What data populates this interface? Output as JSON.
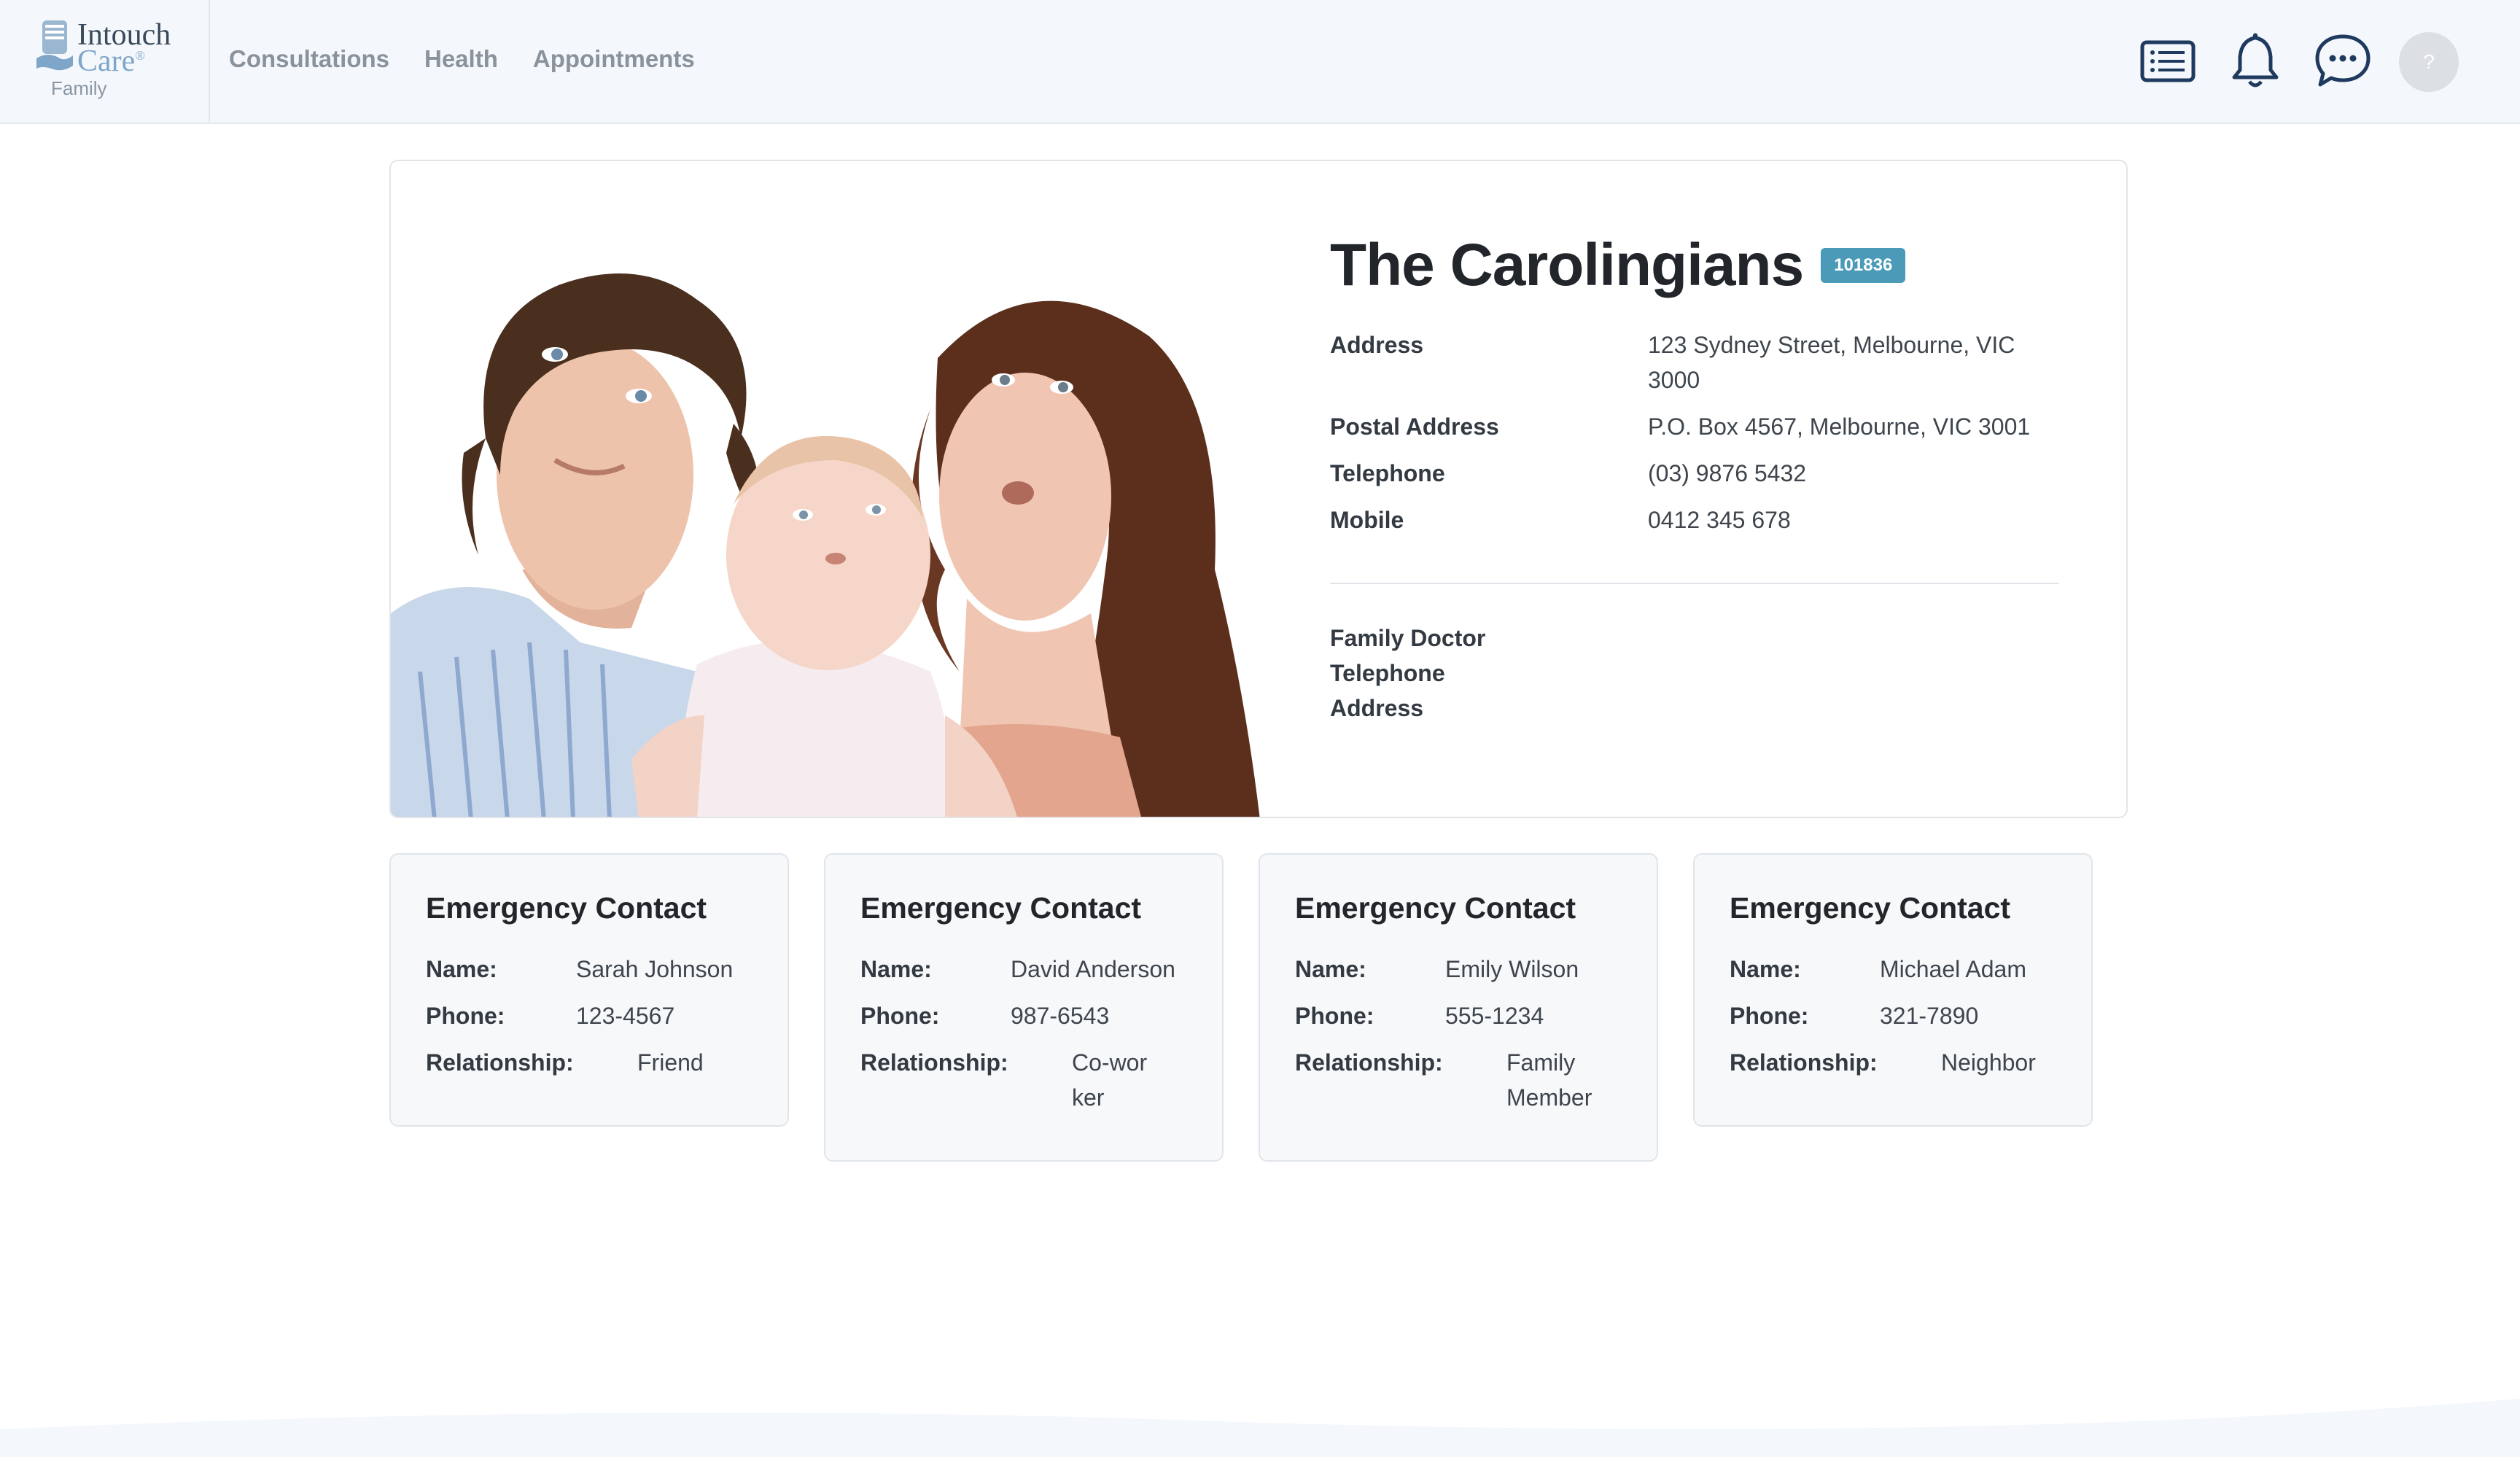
{
  "header": {
    "logo": {
      "line1": "Intouch",
      "line2": "Care",
      "reg": "®",
      "sub": "Family"
    },
    "nav": [
      {
        "label": "Consultations"
      },
      {
        "label": "Health"
      },
      {
        "label": "Appointments"
      }
    ],
    "icons": [
      "list-icon",
      "bell-icon",
      "chat-icon"
    ],
    "avatar_text": "?"
  },
  "family": {
    "name": "The Carolingians",
    "id": "101836",
    "fields": [
      {
        "label": "Address",
        "value": "123 Sydney Street, Melbourne, VIC 3000"
      },
      {
        "label": "Postal Address",
        "value": "P.O. Box 4567, Melbourne, VIC 3001"
      },
      {
        "label": "Telephone",
        "value": "(03) 9876 5432"
      },
      {
        "label": "Mobile",
        "value": "0412 345 678"
      }
    ],
    "doctor_labels": [
      "Family Doctor",
      "Telephone",
      "Address"
    ]
  },
  "emergency_contacts": [
    {
      "title": "Emergency Contact",
      "name_label": "Name:",
      "name": "Sarah Johnson",
      "phone_label": "Phone:",
      "phone": "123-4567",
      "rel_label": "Relationship:",
      "relationship": "Friend"
    },
    {
      "title": "Emergency Contact",
      "name_label": "Name:",
      "name": "David Anderson",
      "phone_label": "Phone:",
      "phone": "987-6543",
      "rel_label": "Relationship:",
      "relationship": "Co-worker"
    },
    {
      "title": "Emergency Contact",
      "name_label": "Name:",
      "name": "Emily Wilson",
      "phone_label": "Phone:",
      "phone": "555-1234",
      "rel_label": "Relationship:",
      "relationship": "Family Member"
    },
    {
      "title": "Emergency Contact",
      "name_label": "Name:",
      "name": "Michael Adam",
      "phone_label": "Phone:",
      "phone": "321-7890",
      "rel_label": "Relationship:",
      "relationship": "Neighbor"
    }
  ],
  "colors": {
    "header_bg": "#f4f8fc",
    "id_badge": "#4a9ab8",
    "icon_navy": "#1f3a5f",
    "card_bg": "#f6f8fa"
  }
}
